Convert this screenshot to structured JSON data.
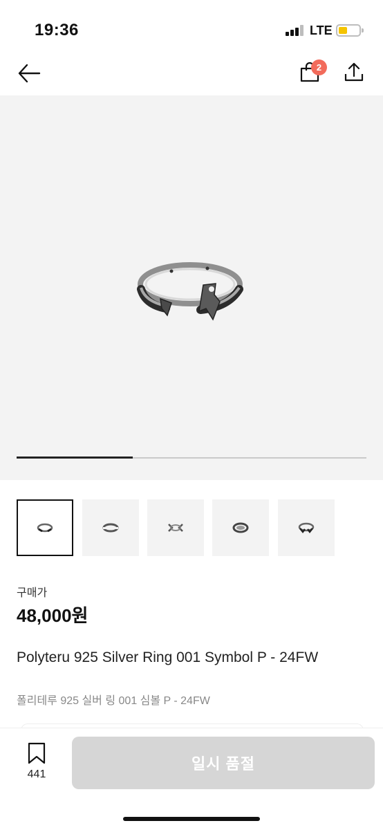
{
  "status": {
    "time": "19:36",
    "network": "LTE",
    "battery_color": "#f5c400"
  },
  "nav": {
    "back_icon": "arrow-left-icon",
    "cart_icon": "shopping-bag-icon",
    "cart_count": "2",
    "share_icon": "share-upload-icon",
    "badge_color": "#f26b5b"
  },
  "gallery": {
    "image_count": 5,
    "current_index": 1,
    "progress_fraction": 0.333,
    "thumbnails": [
      "ring-front",
      "ring-side",
      "ring-top",
      "ring-flat",
      "ring-angle"
    ]
  },
  "product": {
    "price_label": "구매가",
    "price": "48,000원",
    "title_en": "Polyteru 925 Silver Ring 001 Symbol P - 24FW",
    "title_ko": "폴리테루 925 실버 링 001 심볼 P - 24FW"
  },
  "bottom_bar": {
    "bookmark_icon": "bookmark-icon",
    "bookmark_count": "441",
    "action_label": "일시 품절",
    "action_color": "#d6d6d6"
  }
}
